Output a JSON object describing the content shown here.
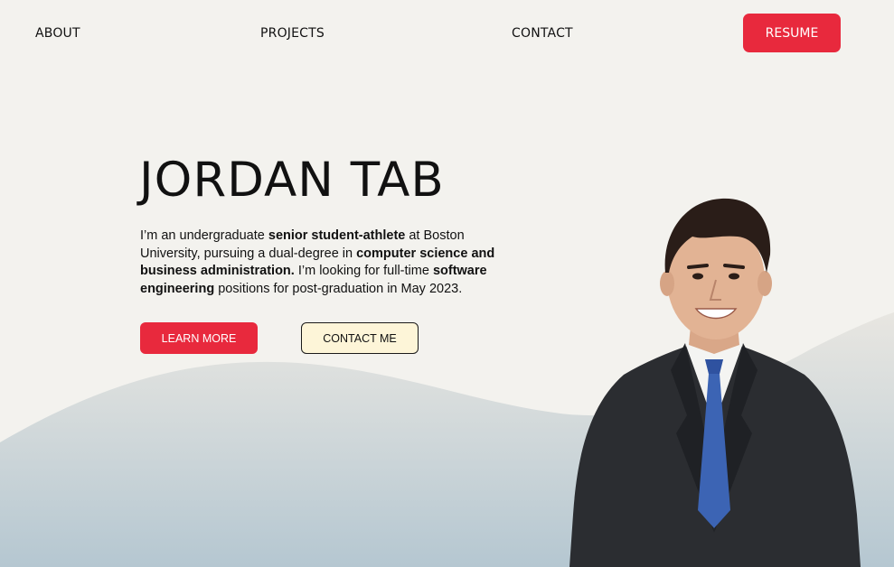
{
  "nav": {
    "about": "ABOUT",
    "projects": "PROJECTS",
    "contact": "CONTACT",
    "resume": "RESUME"
  },
  "hero": {
    "name": "JORDAN TAB",
    "bio": [
      {
        "text": "I’m an undergraduate ",
        "bold": false
      },
      {
        "text": "senior student-athlete",
        "bold": true
      },
      {
        "text": " at Boston University, pursuing a dual-degree in ",
        "bold": false
      },
      {
        "text": "computer science and business administration.",
        "bold": true
      },
      {
        "text": " I’m looking for full-time ",
        "bold": false
      },
      {
        "text": "software engineering",
        "bold": true
      },
      {
        "text": " positions for post-graduation in May 2023.",
        "bold": false
      }
    ],
    "learn_more": "LEARN MORE",
    "contact_me": "CONTACT ME"
  },
  "colors": {
    "background": "#f3f2ee",
    "accent": "#e8293d",
    "contact_button_bg": "#fdf5d8",
    "wave_top": "#e6e4df",
    "wave_bottom": "#b7c8d2",
    "suit": "#2b2d31",
    "tie": "#3c64b4"
  },
  "icons": {
    "portrait": "person-photo"
  }
}
